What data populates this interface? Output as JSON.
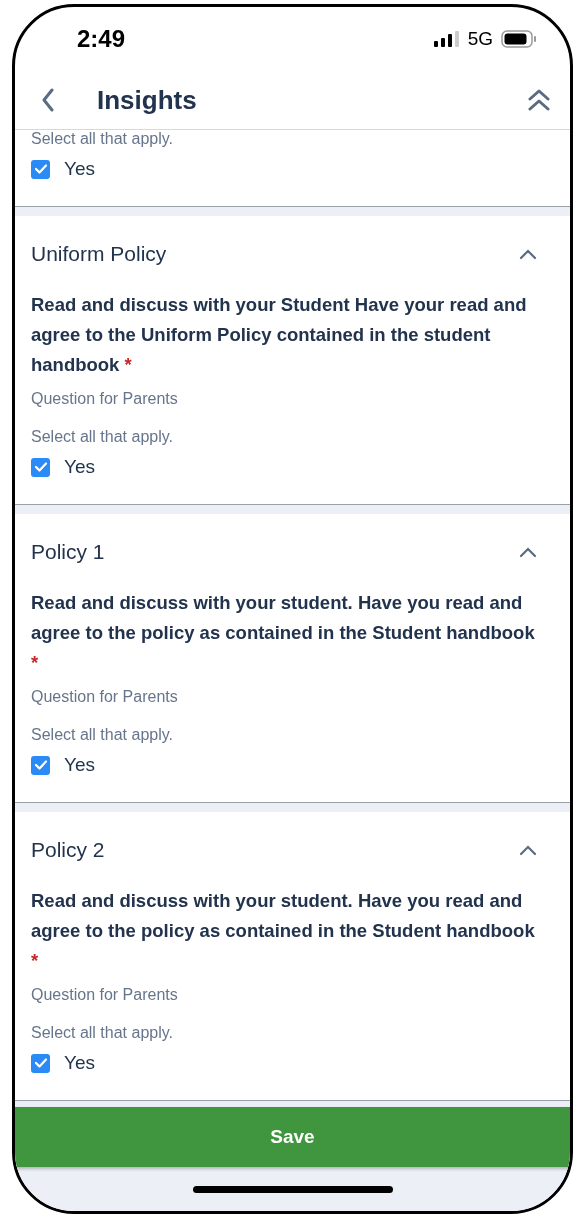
{
  "status_bar": {
    "time": "2:49",
    "network": "5G"
  },
  "header": {
    "title": "Insights"
  },
  "sections": [
    {
      "kind": "partial",
      "select_hint": "Select all that apply.",
      "options": [
        {
          "label": "Yes",
          "checked": true
        }
      ]
    },
    {
      "kind": "full",
      "title": "Uniform Policy",
      "expanded": true,
      "question": "Read and discuss with your Student Have your read and agree to the Uniform Policy contained in the student handbook",
      "required_mark": "*",
      "audience": "Question for Parents",
      "select_hint": "Select all that apply.",
      "options": [
        {
          "label": "Yes",
          "checked": true
        }
      ]
    },
    {
      "kind": "full",
      "title": "Policy 1",
      "expanded": true,
      "question": "Read and discuss with your student. Have you read and agree to the policy as contained in the Student handbook",
      "required_mark": "*",
      "audience": "Question for Parents",
      "select_hint": "Select all that apply.",
      "options": [
        {
          "label": "Yes",
          "checked": true
        }
      ]
    },
    {
      "kind": "full",
      "title": "Policy 2",
      "expanded": true,
      "question": "Read and discuss with your student. Have you read and agree to the policy as contained in the Student handbook",
      "required_mark": "*",
      "audience": "Question for Parents",
      "select_hint": "Select all that apply.",
      "options": [
        {
          "label": "Yes",
          "checked": true
        }
      ]
    }
  ],
  "save_button": "Save"
}
